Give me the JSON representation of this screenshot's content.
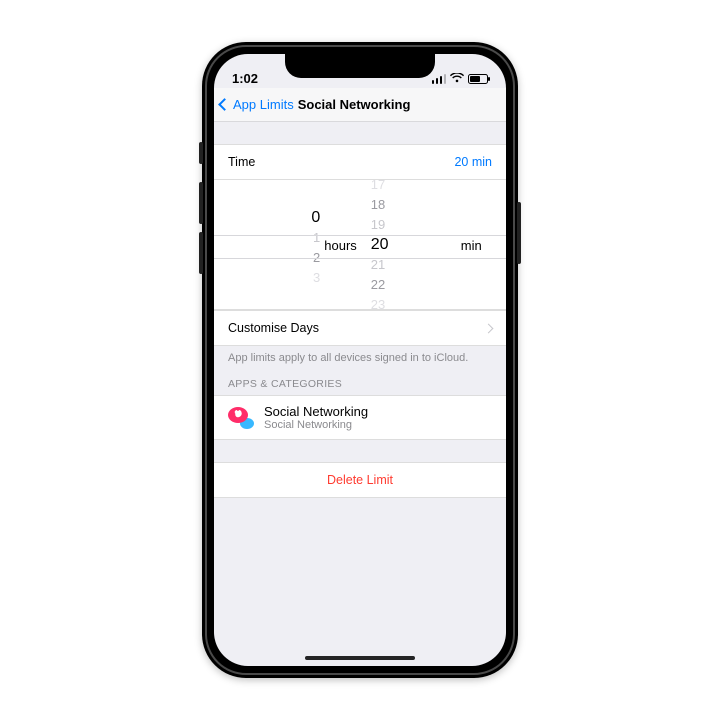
{
  "status": {
    "time": "1:02"
  },
  "nav": {
    "back": "App Limits",
    "title": "Social Networking"
  },
  "time_row": {
    "label": "Time",
    "value": "20 min"
  },
  "picker": {
    "hours_above": [
      "",
      "",
      ""
    ],
    "hours_sel": "0",
    "hours_unit": "hours",
    "hours_below": [
      "1",
      "2",
      "3"
    ],
    "min_above": [
      "17",
      "18",
      "19"
    ],
    "min_sel": "20",
    "min_unit": "min",
    "min_below": [
      "21",
      "22",
      "23"
    ]
  },
  "customise": {
    "label": "Customise Days"
  },
  "footnote": "App limits apply to all devices signed in to iCloud.",
  "section_header": "APPS & CATEGORIES",
  "app": {
    "title": "Social Networking",
    "subtitle": "Social Networking"
  },
  "delete": {
    "label": "Delete Limit"
  }
}
